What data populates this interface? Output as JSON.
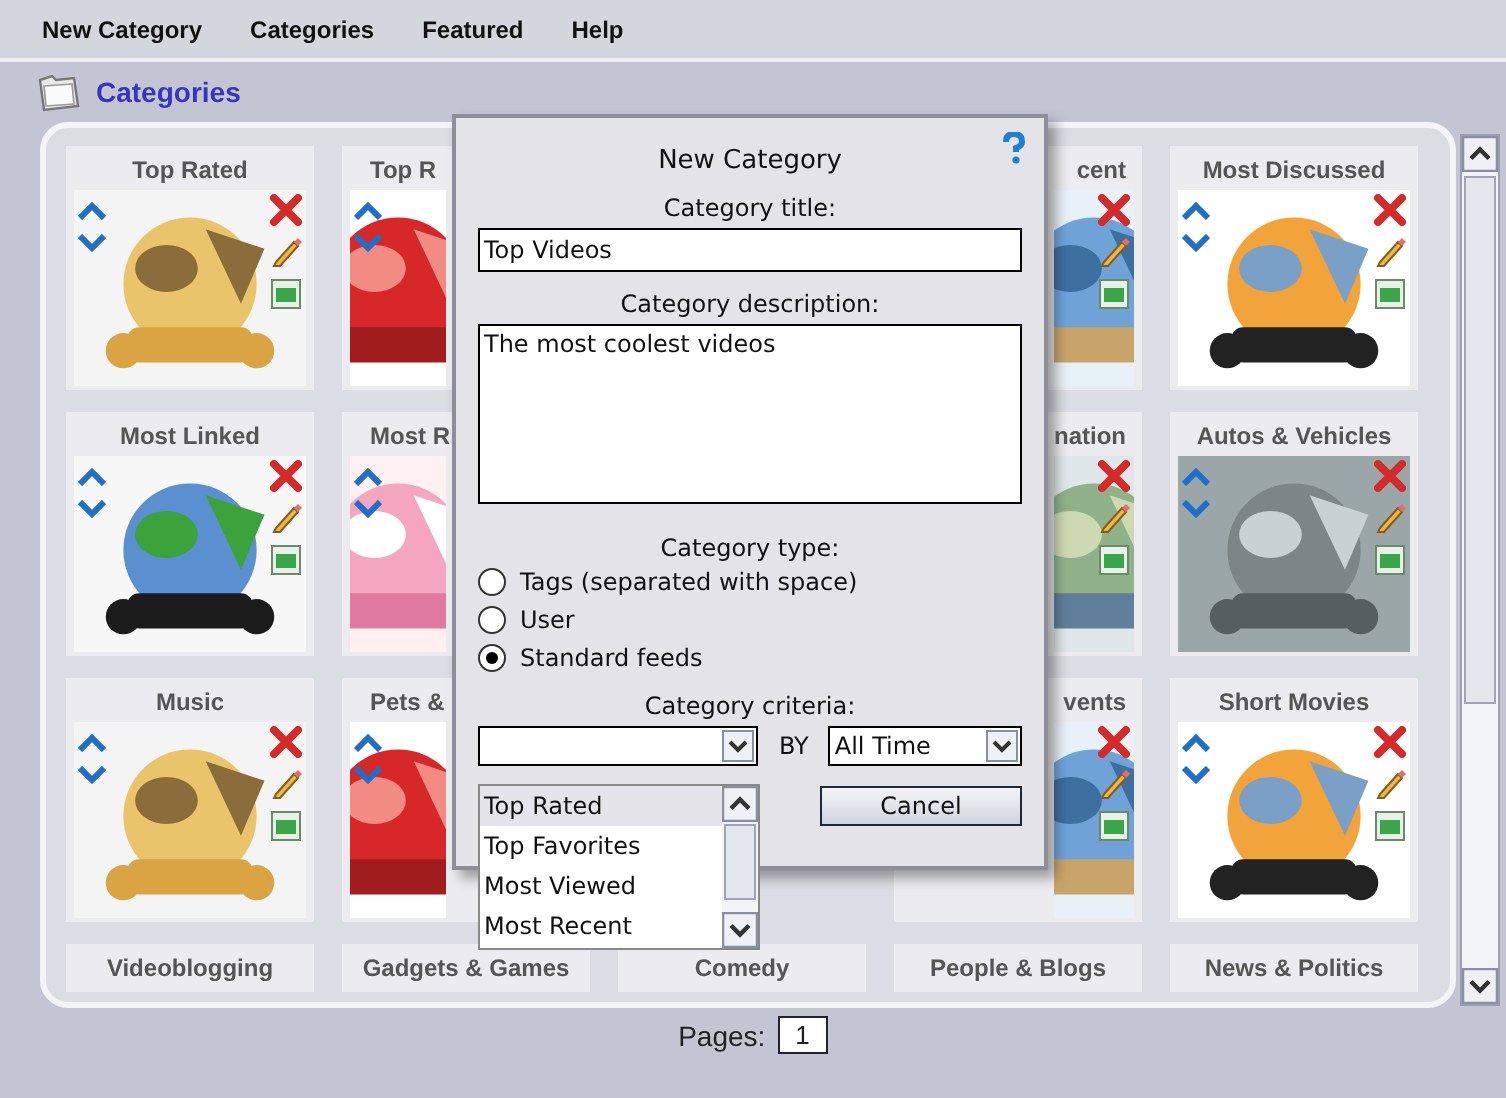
{
  "menu": [
    "New Category",
    "Categories",
    "Featured",
    "Help"
  ],
  "header": {
    "title": "Categories"
  },
  "tiles": [
    {
      "title": "Top Rated",
      "kind": "full"
    },
    {
      "title": "Top R",
      "kind": "left"
    },
    {
      "kind": "hidden"
    },
    {
      "title": "cent",
      "kind": "right"
    },
    {
      "title": "Most Discussed",
      "kind": "full"
    },
    {
      "title": "Most Linked",
      "kind": "full"
    },
    {
      "title": "Most R",
      "kind": "left"
    },
    {
      "kind": "hidden"
    },
    {
      "title": "nation",
      "kind": "right"
    },
    {
      "title": "Autos & Vehicles",
      "kind": "full"
    },
    {
      "title": "Music",
      "kind": "full"
    },
    {
      "title": "Pets &",
      "kind": "left"
    },
    {
      "kind": "hidden"
    },
    {
      "title": "vents",
      "kind": "right"
    },
    {
      "title": "Short Movies",
      "kind": "full"
    },
    {
      "title": "Videoblogging",
      "kind": "strip"
    },
    {
      "title": "Gadgets & Games",
      "kind": "strip"
    },
    {
      "title": "Comedy",
      "kind": "strip"
    },
    {
      "title": "People & Blogs",
      "kind": "strip"
    },
    {
      "title": "News & Politics",
      "kind": "strip"
    }
  ],
  "dialog": {
    "title": "New Category",
    "title_label": "Category title:",
    "title_value": "Top Videos",
    "description_label": "Category description:",
    "description_value": "The most coolest videos",
    "type_label": "Category type:",
    "type_options": [
      {
        "label": "Tags (separated with space)",
        "selected": false
      },
      {
        "label": "User",
        "selected": false
      },
      {
        "label": "Standard feeds",
        "selected": true
      }
    ],
    "criteria_label": "Category criteria:",
    "by_label": "BY",
    "period_value": "All Time",
    "cancel": "Cancel"
  },
  "criteria_list": [
    {
      "label": "Top Rated",
      "selected": true
    },
    {
      "label": "Top Favorites",
      "selected": false
    },
    {
      "label": "Most Viewed",
      "selected": false
    },
    {
      "label": "Most Recent",
      "selected": false
    }
  ],
  "pager": {
    "label": "Pages:",
    "value": "1"
  }
}
